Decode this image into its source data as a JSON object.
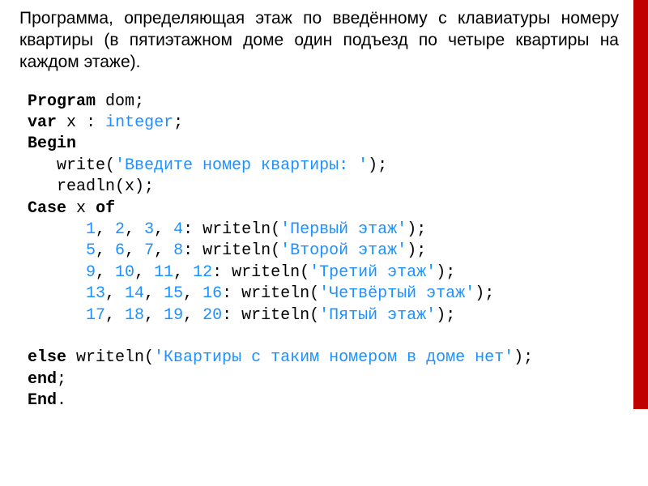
{
  "description": "Программа, определяющая этаж по введённому с клавиатуры номеру квартиры (в пятиэтажном доме один подъезд по четыре квартиры на каждом этаже).",
  "code": {
    "kw_program": "Program",
    "name": "dom",
    "kw_var": "var",
    "var_name": "x",
    "colon": ":",
    "type": "integer",
    "kw_begin": "Begin",
    "write_call": "write(",
    "prompt": "'Введите номер квартиры: '",
    "close_paren_semi": ");",
    "readln": "readln(x);",
    "kw_case": "Case",
    "case_var": "x",
    "kw_of": "of",
    "line1": {
      "nums": [
        "1",
        "2",
        "3",
        "4"
      ],
      "call": ": writeln(",
      "str": "'Первый этаж'",
      "end": ");"
    },
    "line2": {
      "nums": [
        "5",
        "6",
        "7",
        "8"
      ],
      "call": ": writeln(",
      "str": "'Второй этаж'",
      "end": ");"
    },
    "line3": {
      "nums": [
        "9",
        "10",
        "11",
        "12"
      ],
      "call": ": writeln(",
      "str": "'Третий этаж'",
      "end": ");"
    },
    "line4": {
      "nums": [
        "13",
        "14",
        "15",
        "16"
      ],
      "call": ": writeln(",
      "str": "'Четвёртый этаж'",
      "end": ");"
    },
    "line5": {
      "nums": [
        "17",
        "18",
        "19",
        "20"
      ],
      "call": ": writeln(",
      "str": "'Пятый этаж'",
      "end": ");"
    },
    "kw_else": "else",
    "else_call": "writeln(",
    "else_str": "'Квартиры с таким номером в доме нет'",
    "else_end": ");",
    "kw_end_semi": "end",
    "semi": ";",
    "kw_end_dot": "End",
    "dot": "."
  },
  "comma": ", "
}
